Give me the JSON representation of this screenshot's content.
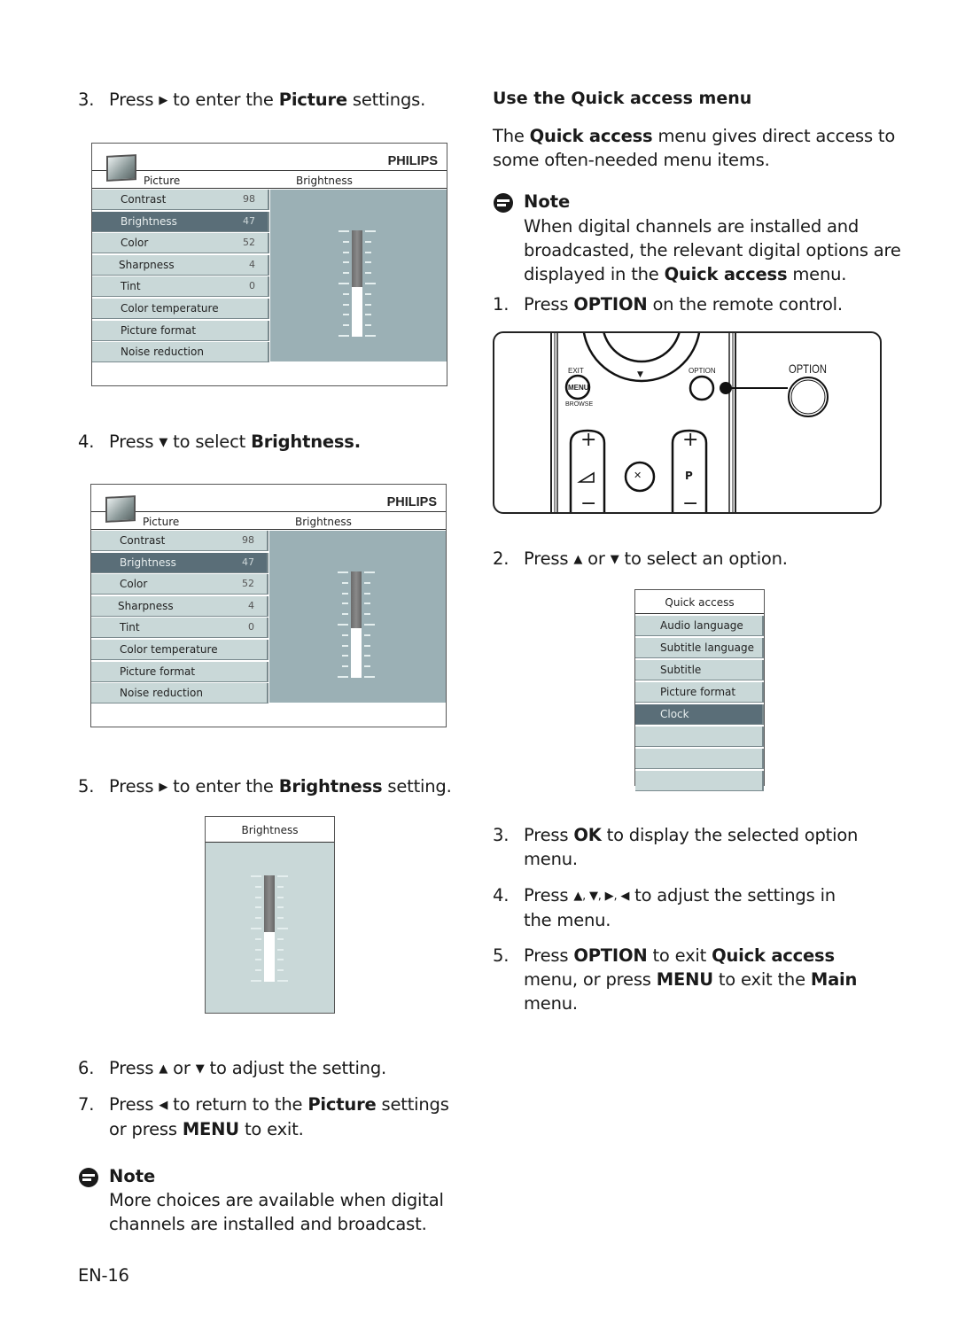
{
  "left_column": {
    "step3": {
      "num": "3.",
      "pre": "Press",
      "icon": "right-arrow",
      "mid": "to enter the",
      "bold": "Picture",
      "post": "settings."
    },
    "step4": {
      "num": "4.",
      "pre": "Press",
      "icon": "down-arrow",
      "mid": "to select",
      "bold": "Brightness."
    },
    "step5": {
      "num": "5.",
      "pre": "Press",
      "icon": "right-arrow",
      "mid": "to enter the",
      "bold": "Brightness",
      "post": "setting."
    },
    "step6": {
      "num": "6.",
      "pre": "Press",
      "icon1": "up-arrow",
      "or": "or",
      "icon2": "down-arrow",
      "post": "to adjust the setting."
    },
    "step7": {
      "num": "7.",
      "pre": "Press",
      "icon": "left-arrow",
      "mid": "to return to the",
      "bold": "Picture",
      "post": "settings",
      "line2_pre": "or press",
      "line2_bold": "MENU",
      "line2_post": "to exit."
    },
    "note": {
      "title": "Note",
      "line1": "More choices are available when digital",
      "line2": "channels are installed and broadcast."
    },
    "page_number": "EN-16"
  },
  "tv_menu": {
    "brand": "PHILIPS",
    "header_left": "Picture",
    "header_right": "Brightness",
    "items": [
      {
        "label": "Contrast",
        "value": "98",
        "selected": false
      },
      {
        "label": "Brightness",
        "value": "47",
        "selected": true
      },
      {
        "label": "Color",
        "value": "52",
        "selected": false
      },
      {
        "label": "Sharpness",
        "value": "4",
        "selected": false
      },
      {
        "label": "Tint",
        "value": "0",
        "selected": false
      },
      {
        "label": "Color temperature",
        "value": "",
        "selected": false
      },
      {
        "label": "Picture format",
        "value": "",
        "selected": false
      },
      {
        "label": "Noise reduction",
        "value": "",
        "selected": false
      }
    ],
    "slider_level_percent": 47
  },
  "brightness_panel": {
    "title": "Brightness",
    "slider_level_percent": 47
  },
  "right_column": {
    "heading": "Use the Quick access menu",
    "intro": {
      "pre": "The",
      "bold": "Quick access",
      "post": "menu gives direct access to",
      "line2": "some often-needed menu items."
    },
    "note": {
      "title": "Note",
      "line1": "When digital channels are installed and",
      "line2": "broadcasted, the relevant digital options are",
      "line3_pre": "displayed in the",
      "line3_bold": "Quick access",
      "line3_post": "menu."
    },
    "step1": {
      "num": "1.",
      "pre": "Press",
      "bold": "OPTION",
      "post": "on the remote control."
    },
    "step2": {
      "num": "2.",
      "pre": "Press",
      "icon1": "up-arrow",
      "or": "or",
      "icon2": "down-arrow",
      "post": "to select an option."
    },
    "step3": {
      "num": "3.",
      "pre": "Press",
      "bold": "OK",
      "post": "to display the selected option",
      "line2": "menu."
    },
    "step4": {
      "num": "4.",
      "pre": "Press",
      "arrows": "▲, ▼, ▶, ◀",
      "post": "to adjust the settings in",
      "line2": "the menu."
    },
    "step5": {
      "num": "5.",
      "pre": "Press",
      "bold": "OPTION",
      "mid": "to exit",
      "bold2": "Quick access",
      "line2_pre": "menu, or press",
      "line2_bold": "MENU",
      "line2_mid": "to exit the",
      "line2_bold2": "Main",
      "line3": "menu."
    }
  },
  "remote": {
    "exit_label": "EXIT",
    "menu_label": "MENU",
    "browse_label": "BROWSE",
    "option_small_label": "OPTION",
    "option_callout_label": "OPTION",
    "down_arrow": "▼",
    "plus": "+",
    "minus": "−",
    "volume_symbol": "◿",
    "program_label": "P",
    "mute_symbol": "🔇"
  },
  "quick_access": {
    "title": "Quick access",
    "items": [
      {
        "label": "Audio language",
        "selected": false
      },
      {
        "label": "Subtitle language",
        "selected": false
      },
      {
        "label": "Subtitle",
        "selected": false
      },
      {
        "label": "Picture format",
        "selected": false
      },
      {
        "label": "Clock",
        "selected": true
      },
      {
        "label": "",
        "selected": false
      },
      {
        "label": "",
        "selected": false
      },
      {
        "label": "",
        "selected": false
      }
    ]
  },
  "glyphs": {
    "right": "▶",
    "down": "▼",
    "up": "▲",
    "left": "◀"
  }
}
